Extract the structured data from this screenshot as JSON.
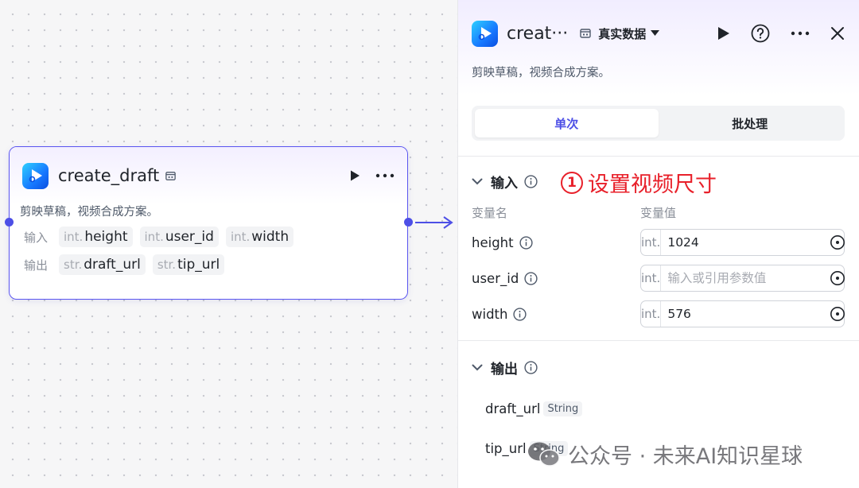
{
  "node": {
    "title": "create_draft",
    "description": "剪映草稿，视频合成方案。",
    "inputs_label": "输入",
    "outputs_label": "输出",
    "inputs": [
      {
        "type": "int.",
        "name": "height"
      },
      {
        "type": "int.",
        "name": "user_id"
      },
      {
        "type": "int.",
        "name": "width"
      }
    ],
    "outputs": [
      {
        "type": "str.",
        "name": "draft_url"
      },
      {
        "type": "str.",
        "name": "tip_url"
      }
    ]
  },
  "panel": {
    "title": "creat···",
    "data_mode": "真实数据",
    "description": "剪映草稿，视频合成方案。",
    "tabs": [
      {
        "label": "单次",
        "active": true
      },
      {
        "label": "批处理",
        "active": false
      }
    ],
    "input_section": {
      "title": "输入",
      "col_name": "变量名",
      "col_value": "变量值",
      "params": [
        {
          "name": "height",
          "type": "int.",
          "value": "1024",
          "placeholder": ""
        },
        {
          "name": "user_id",
          "type": "int.",
          "value": "",
          "placeholder": "输入或引用参数值"
        },
        {
          "name": "width",
          "type": "int.",
          "value": "576",
          "placeholder": ""
        }
      ]
    },
    "output_section": {
      "title": "输出",
      "outputs": [
        {
          "name": "draft_url",
          "type": "String"
        },
        {
          "name": "tip_url",
          "type": "String"
        }
      ]
    }
  },
  "annotation": {
    "number": "1",
    "text": "设置视频尺寸"
  },
  "watermark": {
    "text": "公众号 · 未来AI知识星球"
  },
  "colors": {
    "accent": "#4d4fe6",
    "annotation": "#e8202a",
    "node_border": "#5a55f0"
  }
}
